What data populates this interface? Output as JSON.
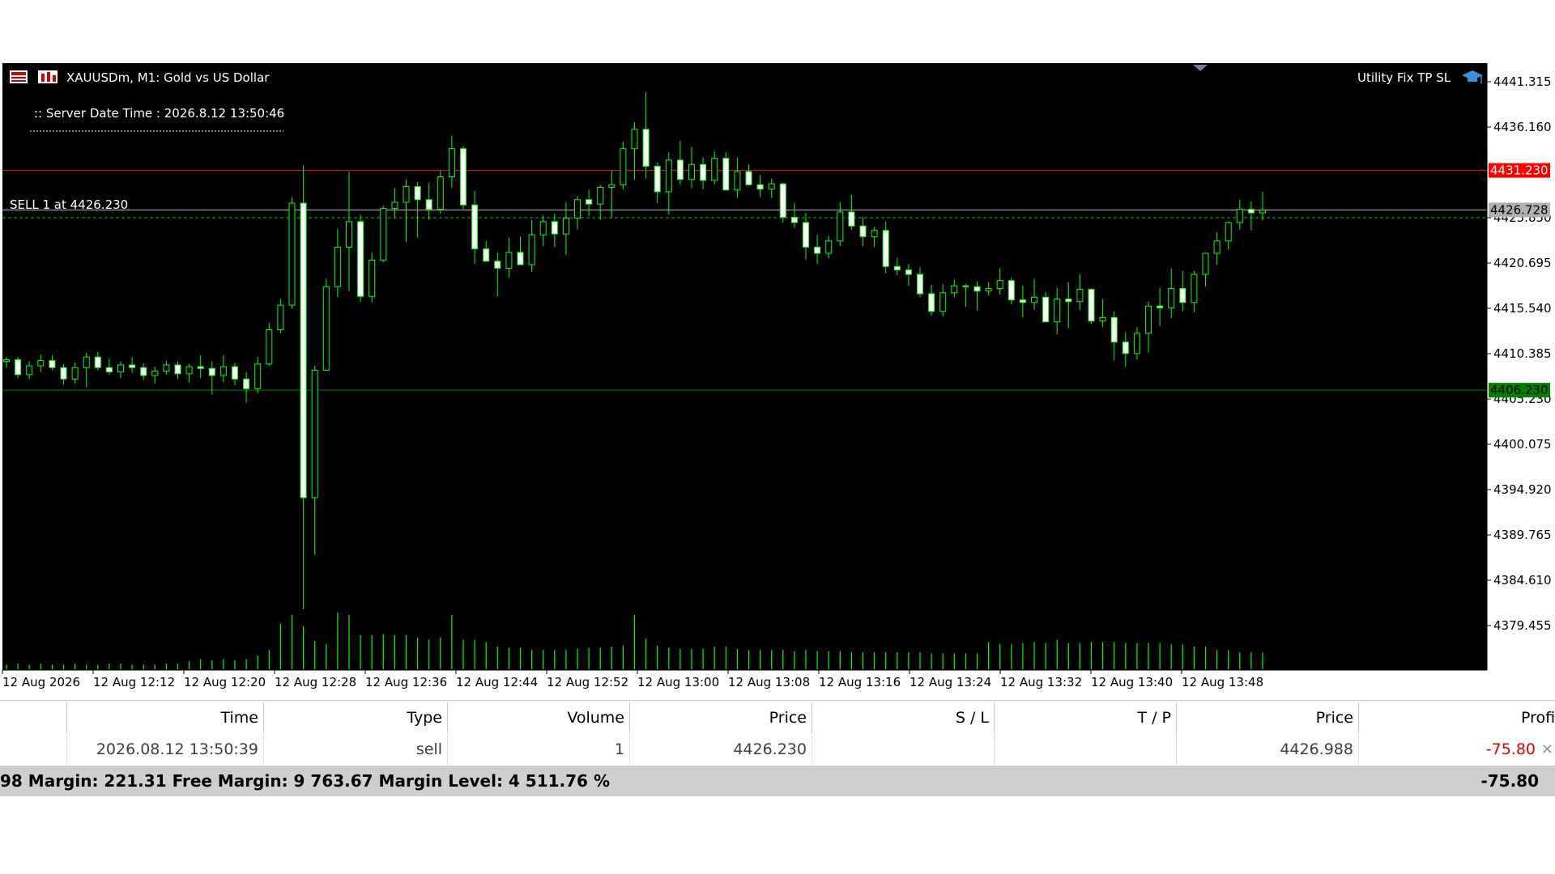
{
  "chart": {
    "symbol_title": "XAUUSDm, M1:  Gold vs US Dollar",
    "server_time_label": ":: Server Date Time : 2026.8.12    13:50:46",
    "indicator_name": "Utility Fix TP SL",
    "sell_label": "SELL 1 at 4426.230",
    "tp_price": "4431.230",
    "sl_price": "4406.230",
    "bid_price": "4426.728",
    "colors": {
      "background": "#000000",
      "bull": "#00ff00",
      "bear_body": "#ffffff",
      "tp_line": "#ff0000",
      "sl_line": "#008000",
      "entry_line": "#00c000",
      "bid_line": "#b0b0b0"
    }
  },
  "chart_data": {
    "type": "candlestick",
    "title": "XAUUSDm, M1:  Gold vs US Dollar",
    "y_ticks": [
      "4441.315",
      "4436.160",
      "4425.850",
      "4420.695",
      "4415.540",
      "4410.385",
      "4405.230",
      "4400.075",
      "4394.920",
      "4389.765",
      "4384.610",
      "4379.455"
    ],
    "y_tick_values": [
      4441.315,
      4436.16,
      4425.85,
      4420.695,
      4415.54,
      4410.385,
      4405.23,
      4400.075,
      4394.92,
      4389.765,
      4384.61,
      4379.455
    ],
    "x_ticks": [
      "12 Aug 2026",
      "12 Aug 12:12",
      "12 Aug 12:20",
      "12 Aug 12:28",
      "12 Aug 12:36",
      "12 Aug 12:44",
      "12 Aug 12:52",
      "12 Aug 13:00",
      "12 Aug 13:08",
      "12 Aug 13:16",
      "12 Aug 13:24",
      "12 Aug 13:32",
      "12 Aug 13:40",
      "12 Aug 13:48"
    ],
    "candles": [
      [
        4409.5,
        4410,
        4408.8,
        4409.7
      ],
      [
        4409.7,
        4410,
        4407.6,
        4408
      ],
      [
        4408,
        4409.5,
        4407.5,
        4409
      ],
      [
        4409,
        4410.3,
        4408.3,
        4409.6
      ],
      [
        4409.6,
        4410.2,
        4408.5,
        4408.8
      ],
      [
        4408.8,
        4409.2,
        4406.9,
        4407.5
      ],
      [
        4407.5,
        4409.4,
        4407,
        4408.8
      ],
      [
        4408.8,
        4410.5,
        4406.6,
        4410
      ],
      [
        4410,
        4410.6,
        4408.5,
        4408.8
      ],
      [
        4408.8,
        4409.8,
        4408,
        4408.3
      ],
      [
        4408.3,
        4409.5,
        4407.6,
        4409.1
      ],
      [
        4409.1,
        4410,
        4408.2,
        4408.8
      ],
      [
        4408.8,
        4409.3,
        4407.4,
        4407.9
      ],
      [
        4407.9,
        4408.9,
        4407,
        4408.4
      ],
      [
        4408.4,
        4409.6,
        4408,
        4409.1
      ],
      [
        4409.1,
        4409.5,
        4407.5,
        4408.1
      ],
      [
        4408.1,
        4409.2,
        4407.1,
        4408.9
      ],
      [
        4408.9,
        4410.2,
        4407.6,
        4408.7
      ],
      [
        4408.7,
        4409.5,
        4405.7,
        4407.9
      ],
      [
        4407.9,
        4410.2,
        4407.1,
        4408.9
      ],
      [
        4408.9,
        4409.3,
        4406.8,
        4407.5
      ],
      [
        4407.5,
        4408.3,
        4404.8,
        4406.4
      ],
      [
        4406.4,
        4410,
        4405.9,
        4409.2
      ],
      [
        4409.2,
        4413.9,
        4409,
        4413.1
      ],
      [
        4413.1,
        4416.6,
        4412.7,
        4415.9
      ],
      [
        4415.9,
        4428.2,
        4415.5,
        4427.5
      ],
      [
        4427.5,
        4431.8,
        4381.3,
        4394
      ],
      [
        4394,
        4409,
        4387.5,
        4408.5
      ],
      [
        4408.5,
        4418.9,
        4408.5,
        4418
      ],
      [
        4418,
        4424.6,
        4416.8,
        4422.5
      ],
      [
        4422.5,
        4431.1,
        4417.5,
        4425.4
      ],
      [
        4425.4,
        4426.2,
        4416.3,
        4416.9
      ],
      [
        4416.9,
        4421.9,
        4416.2,
        4421
      ],
      [
        4421,
        4427.2,
        4420.8,
        4426.9
      ],
      [
        4426.9,
        4429.2,
        4425.8,
        4427.6
      ],
      [
        4427.6,
        4430.2,
        4423.1,
        4429.4
      ],
      [
        4429.4,
        4429.9,
        4423.6,
        4427.9
      ],
      [
        4427.9,
        4429.8,
        4425.6,
        4426.8
      ],
      [
        4426.8,
        4431.2,
        4426.3,
        4430.5
      ],
      [
        4430.5,
        4435.2,
        4429.2,
        4433.7
      ],
      [
        4433.7,
        4434,
        4426.8,
        4427.3
      ],
      [
        4427.3,
        4428.9,
        4420.6,
        4422.3
      ],
      [
        4422.3,
        4423.2,
        4421.7,
        4420.9
      ],
      [
        4420.9,
        4421.9,
        4416.9,
        4420.1
      ],
      [
        4420.1,
        4423.6,
        4419,
        4421.9
      ],
      [
        4421.9,
        4423.7,
        4420.8,
        4420.5
      ],
      [
        4420.5,
        4425.6,
        4419.7,
        4423.9
      ],
      [
        4423.9,
        4426.1,
        4422.6,
        4425.4
      ],
      [
        4425.4,
        4426.3,
        4422.5,
        4424
      ],
      [
        4424,
        4427.6,
        4421.6,
        4425.8
      ],
      [
        4425.8,
        4428.3,
        4424.5,
        4427.9
      ],
      [
        4427.9,
        4429,
        4426,
        4427.4
      ],
      [
        4427.4,
        4429.6,
        4425.6,
        4429.3
      ],
      [
        4429.3,
        4431.2,
        4425.9,
        4429.6
      ],
      [
        4429.6,
        4434.5,
        4429.1,
        4433.7
      ],
      [
        4433.7,
        4436.7,
        4430.2,
        4435.9
      ],
      [
        4435.9,
        4440.1,
        4430.3,
        4431.7
      ],
      [
        4431.7,
        4432.1,
        4427.5,
        4428.8
      ],
      [
        4428.8,
        4433.3,
        4426.2,
        4432.4
      ],
      [
        4432.4,
        4434.6,
        4429.6,
        4430.2
      ],
      [
        4430.2,
        4433.9,
        4429.2,
        4431.9
      ],
      [
        4431.9,
        4432.7,
        4429.1,
        4430.1
      ],
      [
        4430.1,
        4433.4,
        4429.6,
        4432.6
      ],
      [
        4432.6,
        4433.3,
        4429.7,
        4429
      ],
      [
        4429,
        4432.7,
        4428.1,
        4431.1
      ],
      [
        4431.1,
        4431.9,
        4429.5,
        4429.6
      ],
      [
        4429.6,
        4430.7,
        4428.2,
        4429.1
      ],
      [
        4429.1,
        4430.3,
        4428.1,
        4429.7
      ],
      [
        4429.7,
        4429.8,
        4425.3,
        4425.9
      ],
      [
        4425.9,
        4427.5,
        4424.7,
        4425.3
      ],
      [
        4425.3,
        4426.4,
        4421.1,
        4422.5
      ],
      [
        4422.5,
        4423.9,
        4420.6,
        4421.8
      ],
      [
        4421.8,
        4423.8,
        4421.2,
        4423.2
      ],
      [
        4423.2,
        4427.6,
        4422.6,
        4426.5
      ],
      [
        4426.5,
        4428.4,
        4424.5,
        4424.9
      ],
      [
        4424.9,
        4425.9,
        4422.6,
        4423.7
      ],
      [
        4423.7,
        4424.8,
        4422.5,
        4424.4
      ],
      [
        4424.4,
        4425.4,
        4419.5,
        4420.3
      ],
      [
        4420.3,
        4421.3,
        4419.3,
        4419.9
      ],
      [
        4419.9,
        4420.6,
        4418.1,
        4419.4
      ],
      [
        4419.4,
        4420.2,
        4416.8,
        4417.2
      ],
      [
        4417.2,
        4418.2,
        4414.7,
        4415.2
      ],
      [
        4415.2,
        4418.3,
        4414.6,
        4417.3
      ],
      [
        4417.3,
        4418.8,
        4416.8,
        4418.1
      ],
      [
        4418.1,
        4418.3,
        4415.7,
        4418
      ],
      [
        4418,
        4418.6,
        4415.3,
        4417.5
      ],
      [
        4417.5,
        4418.5,
        4417,
        4417.8
      ],
      [
        4417.8,
        4420.1,
        4417.1,
        4418.7
      ],
      [
        4418.7,
        4419,
        4416,
        4416.5
      ],
      [
        4416.5,
        4418.1,
        4414.5,
        4416.2
      ],
      [
        4416.2,
        4418.9,
        4415.4,
        4416.8
      ],
      [
        4416.8,
        4417.4,
        4414.7,
        4414
      ],
      [
        4414,
        4417.9,
        4412.6,
        4416.6
      ],
      [
        4416.6,
        4418.5,
        4413.3,
        4416.3
      ],
      [
        4416.3,
        4419.4,
        4415.3,
        4417.7
      ],
      [
        4417.7,
        4417.8,
        4413.8,
        4414.1
      ],
      [
        4414.1,
        4416.6,
        4413.4,
        4414.5
      ],
      [
        4414.5,
        4415.2,
        4409.6,
        4411.7
      ],
      [
        4411.7,
        4412.8,
        4408.9,
        4410.4
      ],
      [
        4410.4,
        4413.4,
        4409.7,
        4412.7
      ],
      [
        4412.7,
        4416.3,
        4410.5,
        4415.8
      ],
      [
        4415.8,
        4417.9,
        4413.5,
        4415.6
      ],
      [
        4415.6,
        4420.1,
        4414.4,
        4417.8
      ],
      [
        4417.8,
        4419.8,
        4415.2,
        4416.2
      ],
      [
        4416.2,
        4419.8,
        4415.1,
        4419.4
      ],
      [
        4419.4,
        4421.2,
        4418,
        4421.8
      ],
      [
        4421.8,
        4424.2,
        4420.5,
        4423.2
      ],
      [
        4423.2,
        4425.4,
        4422.2,
        4425.3
      ],
      [
        4425.3,
        4427.9,
        4424.5,
        4426.8
      ],
      [
        4426.8,
        4427.7,
        4424.4,
        4426.4
      ],
      [
        4426.4,
        4428.8,
        4425.5,
        4426.7
      ]
    ],
    "volumes": [
      4,
      5,
      4,
      5,
      4,
      4,
      5,
      4,
      4,
      5,
      5,
      4,
      4,
      4,
      5,
      5,
      7,
      9,
      8,
      9,
      8,
      9,
      12,
      17,
      40,
      48,
      38,
      25,
      22,
      50,
      48,
      30,
      30,
      31,
      30,
      30,
      28,
      26,
      28,
      48,
      26,
      26,
      24,
      20,
      19,
      19,
      17,
      17,
      17,
      17,
      18,
      19,
      19,
      20,
      21,
      48,
      27,
      21,
      19,
      18,
      18,
      18,
      20,
      20,
      18,
      17,
      17,
      17,
      17,
      16,
      17,
      16,
      16,
      16,
      15,
      15,
      15,
      15,
      15,
      15,
      15,
      14,
      14,
      14,
      14,
      14,
      24,
      22,
      22,
      23,
      24,
      23,
      26,
      23,
      23,
      24,
      24,
      24,
      23,
      23,
      23,
      23,
      22,
      22,
      20,
      20,
      17,
      17,
      15,
      15,
      15
    ]
  },
  "trade_table": {
    "headers": [
      "Time",
      "Type",
      "Volume",
      "Price",
      "S / L",
      "T / P",
      "Price",
      "Profit"
    ],
    "row": [
      "2026.08.12 13:50:39",
      "sell",
      "1",
      "4426.230",
      "",
      "",
      "4426.988",
      "-75.80"
    ],
    "profit_color": "#e00000",
    "summary": "98  Margin: 221.31  Free Margin: 9 763.67  Margin Level: 4 511.76 %",
    "total": "-75.80",
    "close_icon": "×"
  }
}
